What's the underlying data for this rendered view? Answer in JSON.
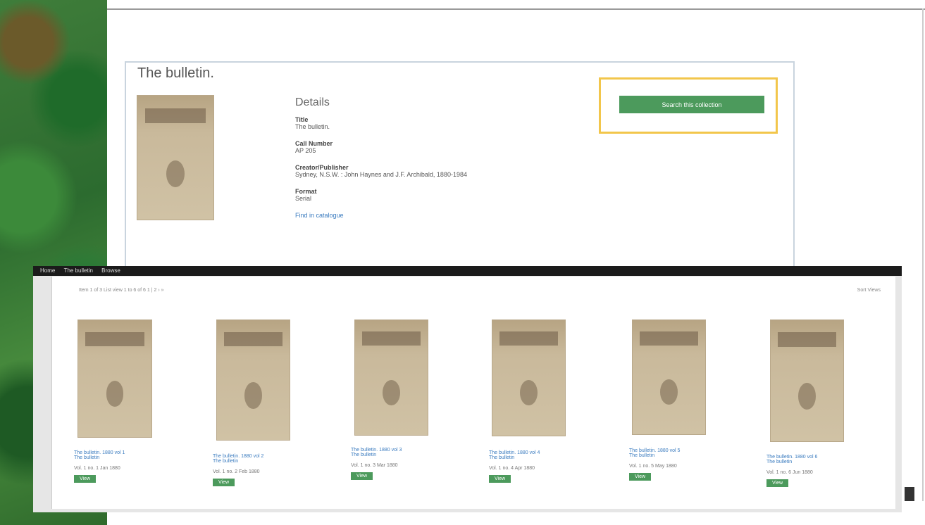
{
  "record": {
    "title": "The bulletin.",
    "details_heading": "Details",
    "fields": [
      {
        "label": "Title",
        "value": "The bulletin."
      },
      {
        "label": "Call Number",
        "value": "AP 205"
      },
      {
        "label": "Creator/Publisher",
        "value": "Sydney, N.S.W. : John Haynes and J.F. Archibald, 1880-1984"
      },
      {
        "label": "Format",
        "value": "Serial"
      }
    ],
    "more_link": "Find in catalogue",
    "action_button": "Search this collection"
  },
  "viewer": {
    "tabs": [
      "Home",
      "The bulletin",
      "Browse"
    ],
    "toolbar_left": "Item 1 of 3    List view    1 to 6 of 6         1   |   2   ›   »",
    "toolbar_right": "Sort Views"
  },
  "items": [
    {
      "line1": "The bulletin. 1880 vol 1",
      "line2": "The bulletin",
      "line3": "Vol. 1 no. 1 Jan 1880",
      "button": "View"
    },
    {
      "line1": "The bulletin. 1880 vol 2",
      "line2": "The bulletin",
      "line3": "Vol. 1 no. 2 Feb 1880",
      "button": "View"
    },
    {
      "line1": "The bulletin. 1880 vol 3",
      "line2": "The bulletin",
      "line3": "Vol. 1 no. 3 Mar 1880",
      "button": "View"
    },
    {
      "line1": "The bulletin. 1880 vol 4",
      "line2": "The bulletin",
      "line3": "Vol. 1 no. 4 Apr 1880",
      "button": "View"
    },
    {
      "line1": "The bulletin. 1880 vol 5",
      "line2": "The bulletin",
      "line3": "Vol. 1 no. 5 May 1880",
      "button": "View"
    },
    {
      "line1": "The bulletin. 1880 vol 6",
      "line2": "The bulletin",
      "line3": "Vol. 1 no. 6 Jun 1880",
      "button": "View"
    }
  ]
}
